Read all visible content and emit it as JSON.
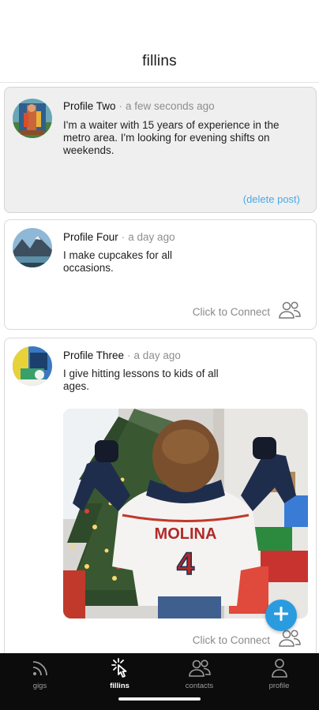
{
  "app": {
    "title": "fillins"
  },
  "posts": [
    {
      "author": "Profile Two",
      "time": "a few seconds ago",
      "text": "I'm a waiter with 15 years of experience in the metro area. I'm looking for evening shifts on weekends.",
      "action": "(delete post)"
    },
    {
      "author": "Profile Four",
      "time": "a day ago",
      "text": "I make cupcakes for all occasions.",
      "action": "Click to Connect"
    },
    {
      "author": "Profile Three",
      "time": "a day ago",
      "text": "I give hitting lessons to kids of all ages.",
      "action": "Click to Connect",
      "image_jersey_text": {
        "name": "MOLINA",
        "number": "4"
      }
    }
  ],
  "tabs": [
    {
      "label": "gigs",
      "icon": "gigs-icon",
      "active": false
    },
    {
      "label": "fillins",
      "icon": "fillins-icon",
      "active": true
    },
    {
      "label": "contacts",
      "icon": "contacts-icon",
      "active": false
    },
    {
      "label": "profile",
      "icon": "profile-icon",
      "active": false
    }
  ],
  "colors": {
    "accent": "#2b9be0",
    "link": "#4aa9e6",
    "tab_bar": "#0c0c0c",
    "own_post_bg": "#efefef"
  }
}
